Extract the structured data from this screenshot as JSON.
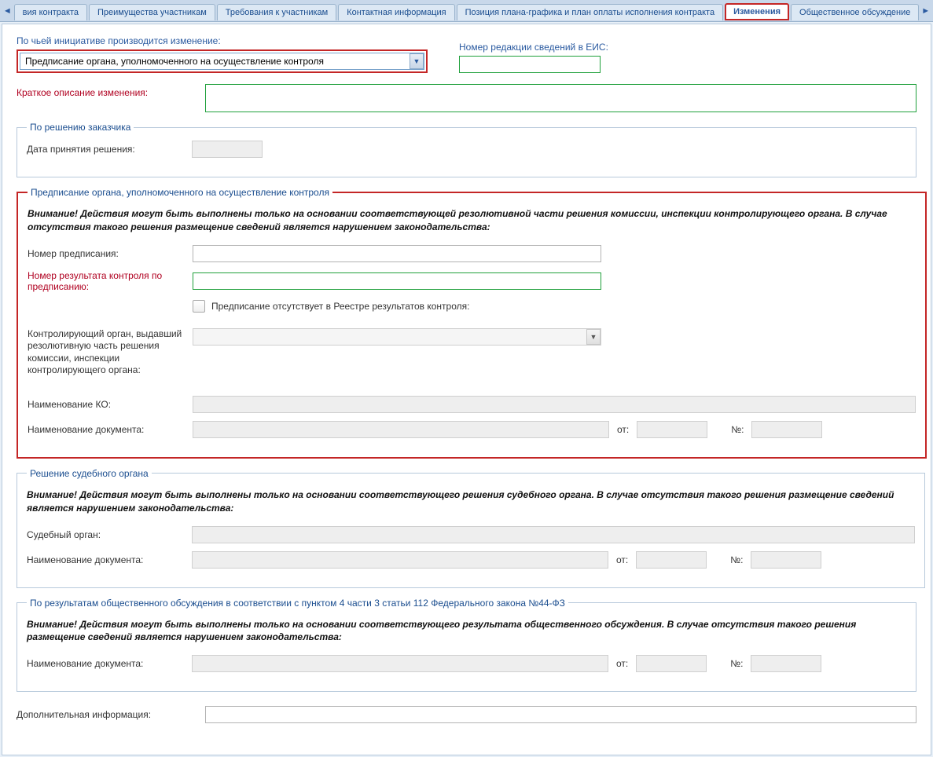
{
  "tabs": {
    "scroll_left": "◄",
    "scroll_right": "►",
    "t0": "вия контракта",
    "t1": "Преимущества участникам",
    "t2": "Требования к участникам",
    "t3": "Контактная информация",
    "t4": "Позиция плана-графика и план оплаты исполнения контракта",
    "t5": "Изменения",
    "t6": "Общественное обсуждение"
  },
  "top": {
    "initiative_label": "По чьей инициативе производится изменение:",
    "initiative_value": "Предписание органа, уполномоченного на осуществление контроля",
    "eis_label": "Номер редакции сведений в ЕИС:",
    "eis_value": "",
    "short_desc_label": "Краткое описание изменения:",
    "short_desc_value": ""
  },
  "customer": {
    "legend": "По решению заказчика",
    "date_label": "Дата принятия решения:",
    "date_value": ""
  },
  "prescript": {
    "legend": "Предписание органа, уполномоченного на осуществление контроля",
    "warning": "Внимание! Действия могут быть выполнены только на основании соответствующей резолютивной части решения комиссии, инспекции контролирующего органа. В случае отсутствия такого решения размещение сведений является нарушением законодательства:",
    "presc_no_label": "Номер предписания:",
    "presc_no_value": "",
    "result_no_label": "Номер результата контроля по предписанию:",
    "result_no_value": "",
    "checkbox_label": "Предписание отсутствует в Реестре результатов контроля:",
    "org_label": "Контролирующий орган, выдавший резолютивную часть решения комиссии, инспекции контролирующего органа:",
    "org_value": "",
    "ko_label": "Наименование КО:",
    "ko_value": "",
    "doc_label": "Наименование документа:",
    "doc_value": "",
    "from_label": "от:",
    "from_value": "",
    "num_label": "№:",
    "num_value": ""
  },
  "court": {
    "legend": "Решение судебного органа",
    "warning": "Внимание! Действия могут быть выполнены только на основании соответствующего решения судебного органа. В случае отсутствия такого решения размещение сведений является нарушением законодательства:",
    "org_label": "Судебный орган:",
    "org_value": "",
    "doc_label": "Наименование документа:",
    "doc_value": "",
    "from_label": "от:",
    "from_value": "",
    "num_label": "№:",
    "num_value": ""
  },
  "pub": {
    "legend": "По результатам общественного обсуждения в соответствии с пунктом 4 части 3 статьи 112 Федерального закона №44-ФЗ",
    "warning": "Внимание! Действия могут быть выполнены только на основании соответствующего результата общественного обсуждения. В случае отсутствия такого решения размещение сведений является нарушением законодательства:",
    "doc_label": "Наименование документа:",
    "doc_value": "",
    "from_label": "от:",
    "from_value": "",
    "num_label": "№:",
    "num_value": ""
  },
  "extra": {
    "label": "Дополнительная информация:",
    "value": ""
  }
}
